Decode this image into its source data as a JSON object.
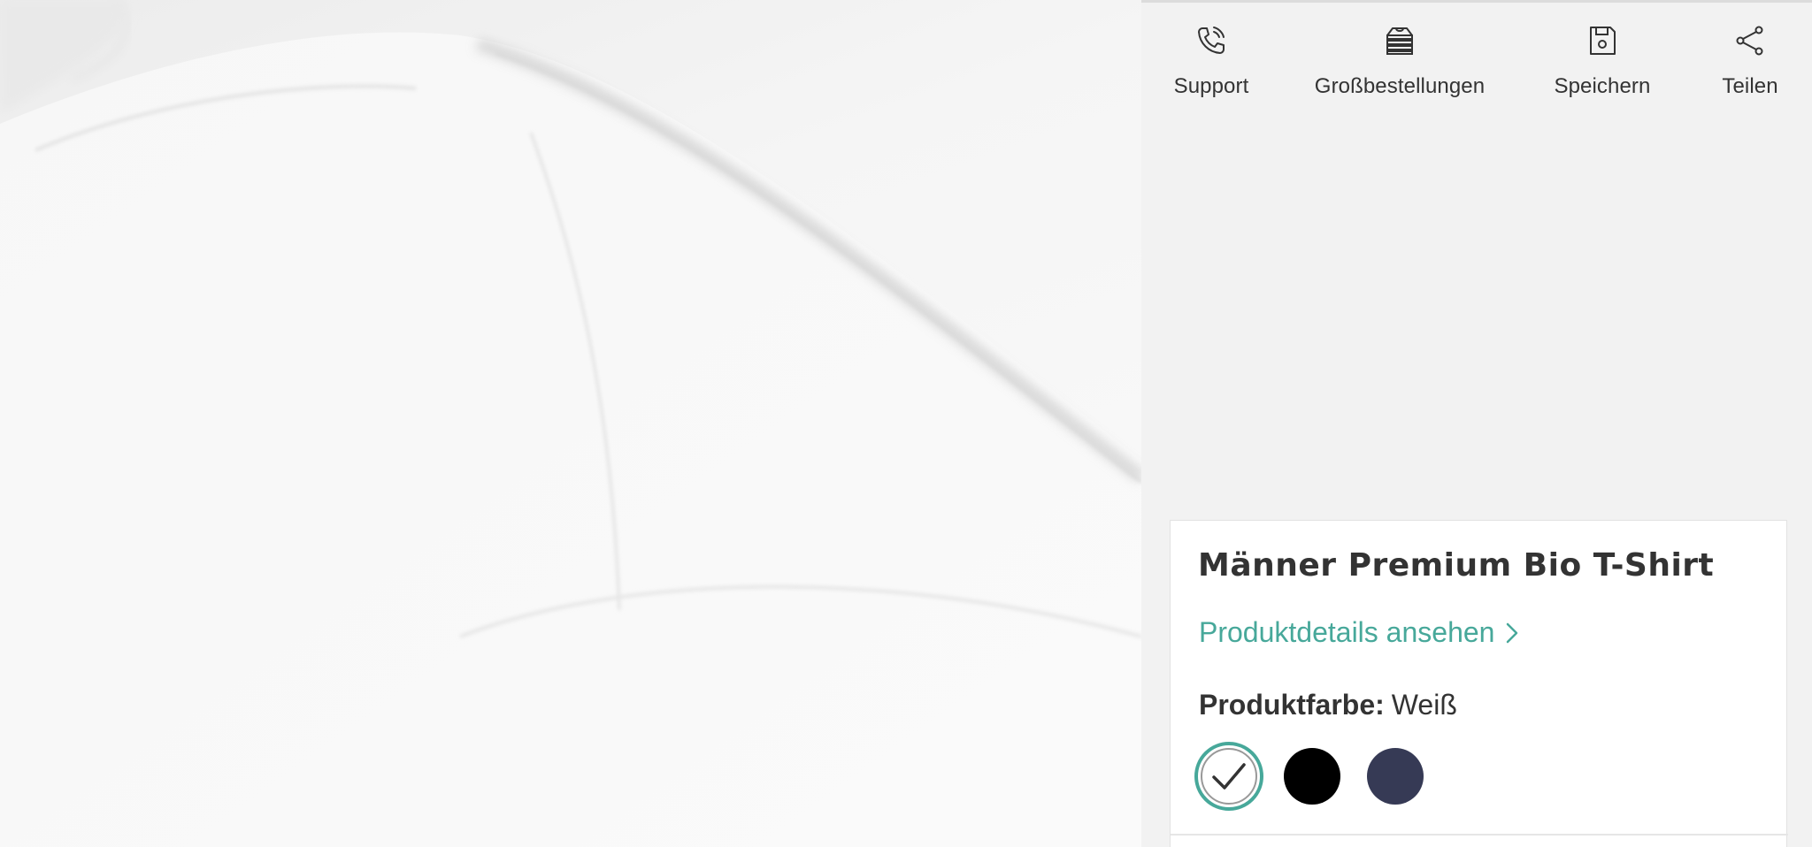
{
  "actions": [
    {
      "label": "Support",
      "icon": "phone-icon"
    },
    {
      "label": "Großbestellungen",
      "icon": "stacked-shirts-icon"
    },
    {
      "label": "Speichern",
      "icon": "save-icon"
    },
    {
      "label": "Teilen",
      "icon": "share-icon"
    }
  ],
  "product": {
    "title": "Männer Premium Bio T-Shirt",
    "details_link": "Produktdetails ansehen",
    "color_label": "Produktfarbe:",
    "color_value": "Weiß"
  },
  "swatches": [
    {
      "name": "Weiß",
      "color": "#ffffff",
      "selected": true
    },
    {
      "name": "Schwarz",
      "color": "#000000",
      "selected": false
    },
    {
      "name": "Navy",
      "color": "#363a55",
      "selected": false
    }
  ],
  "colors": {
    "accent": "#47a89a",
    "background": "#f2f2f2",
    "text": "#333333"
  }
}
